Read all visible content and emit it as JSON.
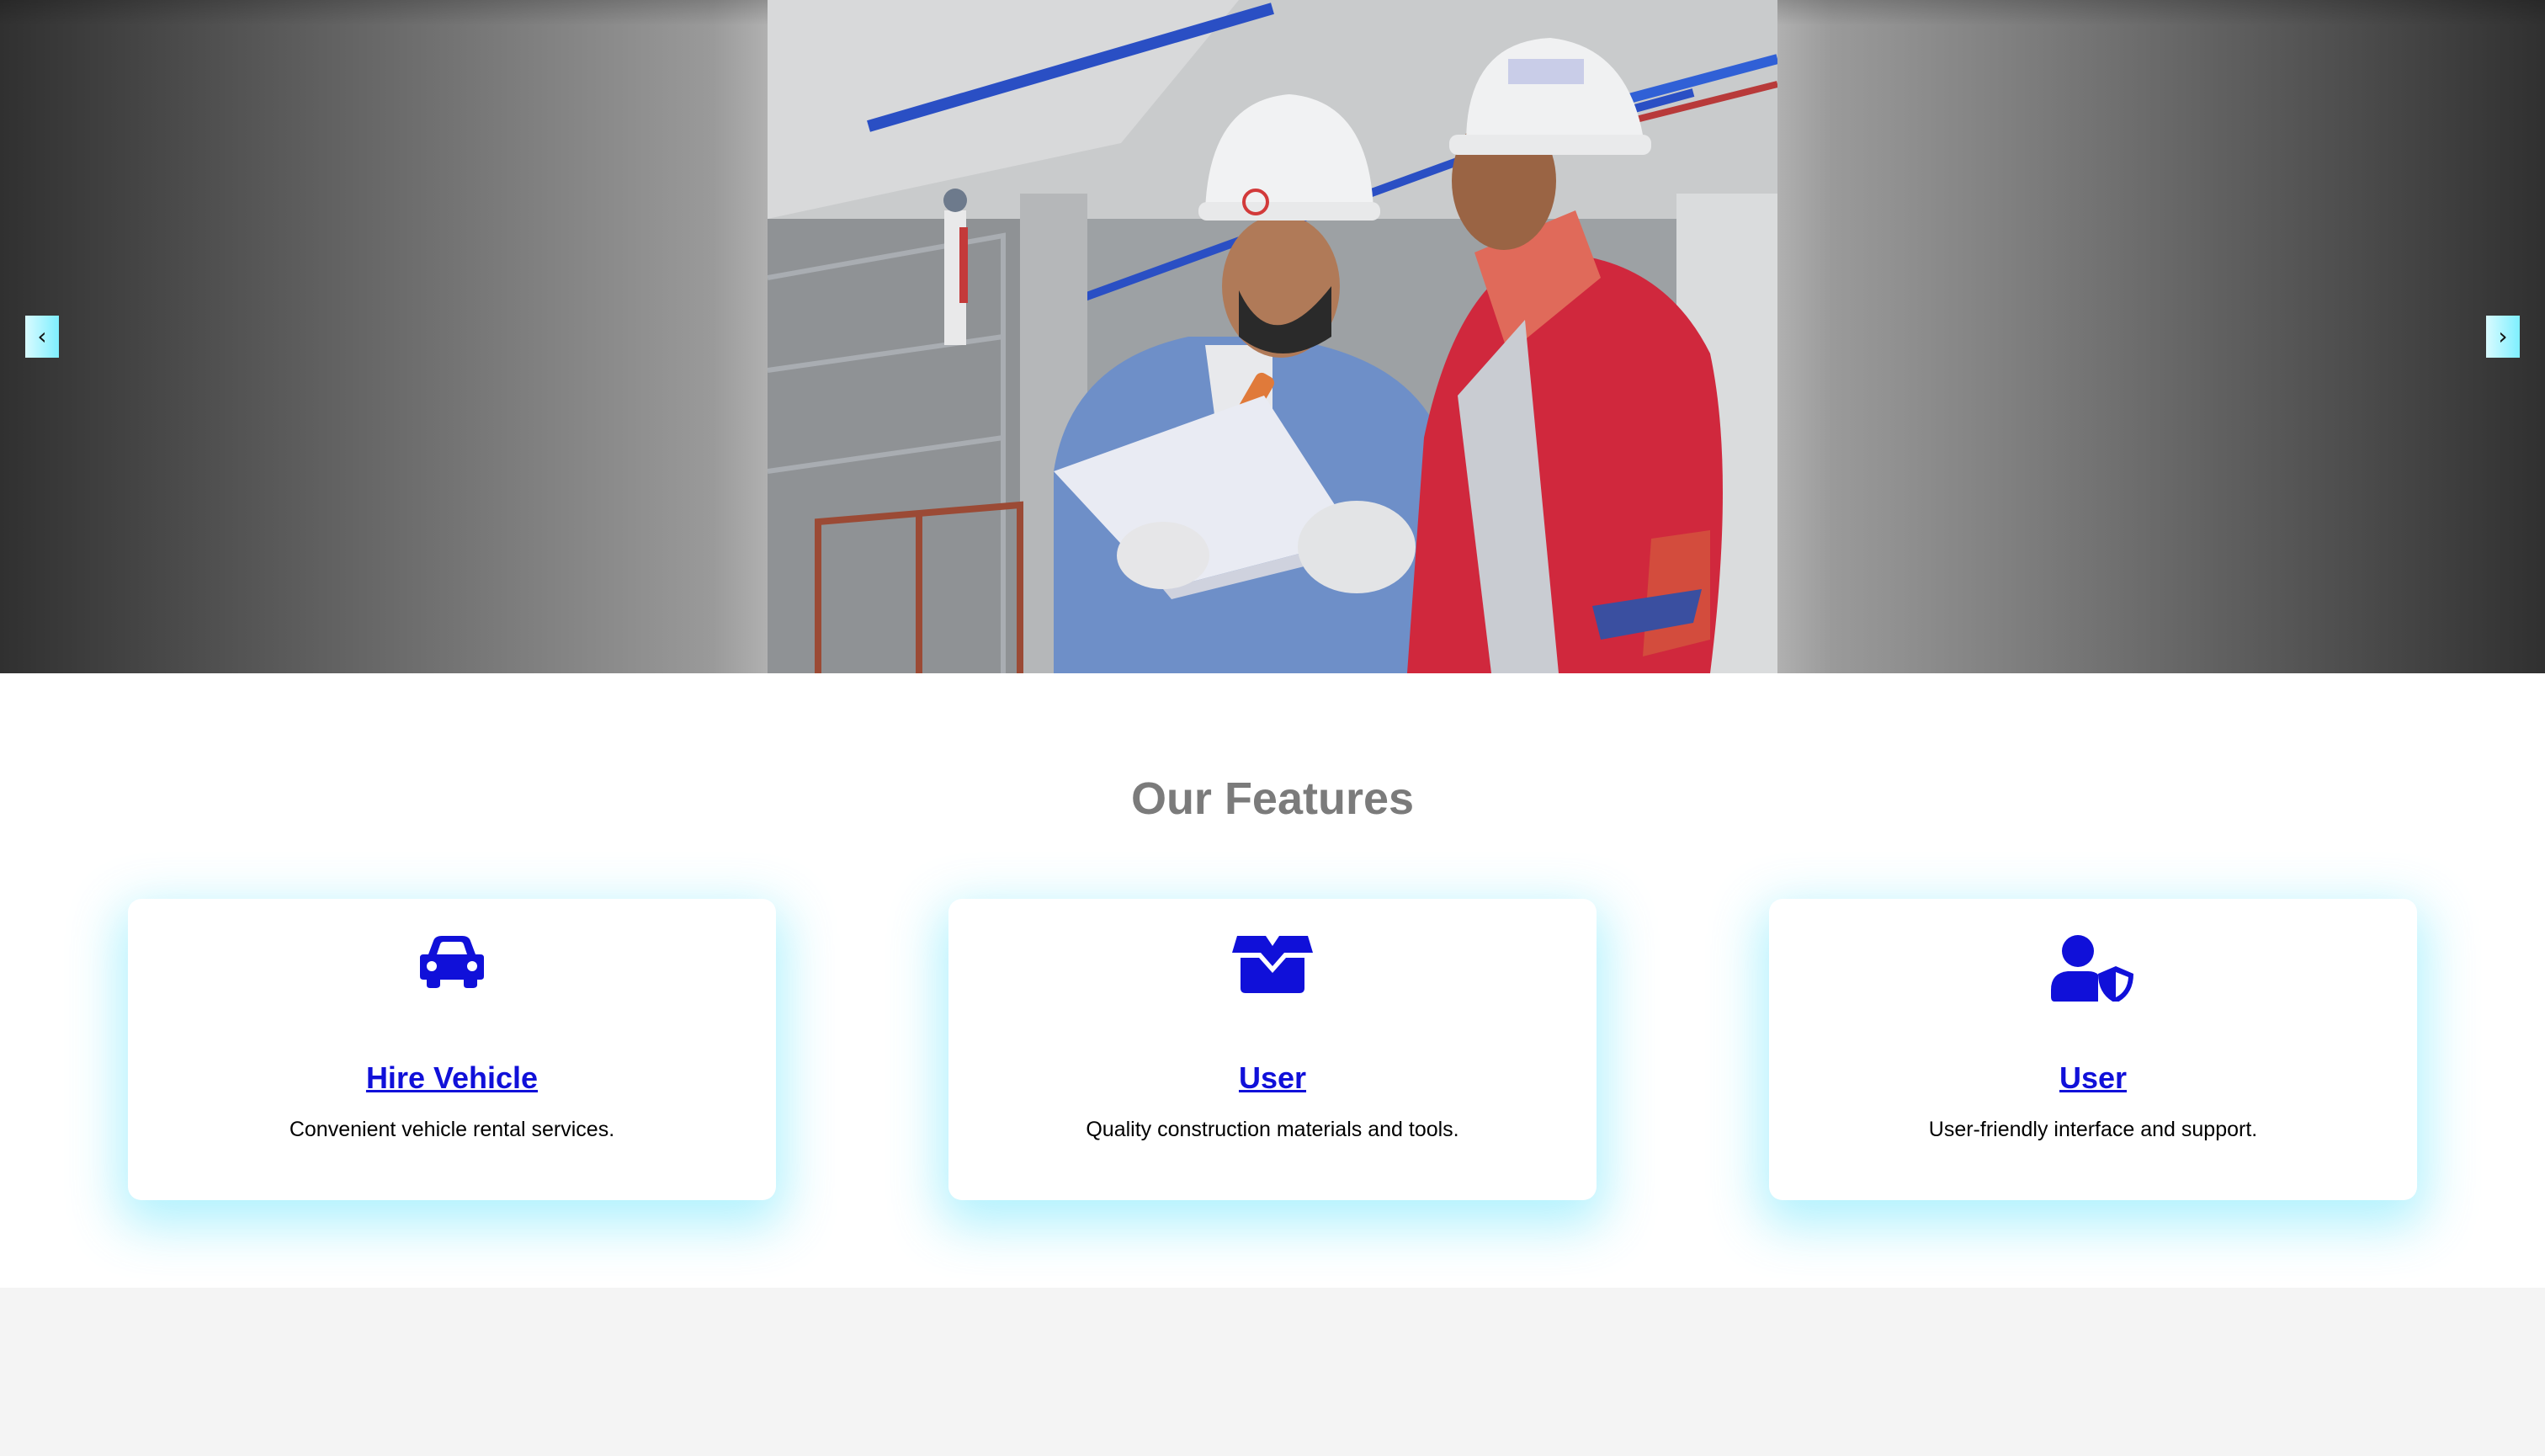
{
  "carousel": {
    "prev_label": "‹",
    "next_label": "›",
    "image_alt": "construction workers reviewing plans"
  },
  "features": {
    "title": "Our Features",
    "cards": [
      {
        "icon": "car-icon",
        "title": "Hire Vehicle",
        "description": "Convenient vehicle rental services."
      },
      {
        "icon": "box-icon",
        "title": "User",
        "description": "Quality construction materials and tools."
      },
      {
        "icon": "user-shield-icon",
        "title": "User",
        "description": "User-friendly interface and support."
      }
    ]
  },
  "colors": {
    "accent_blue": "#1010d9",
    "glow_cyan": "#50e1fa",
    "heading_gray": "#7b7b7b",
    "button_cyan": "#7eefff"
  }
}
